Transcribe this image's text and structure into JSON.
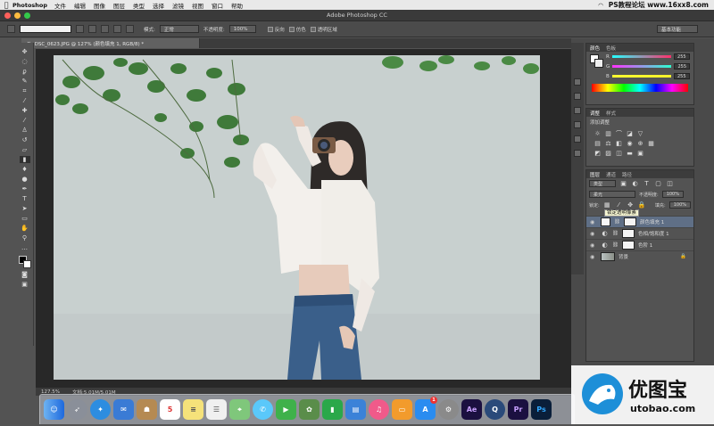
{
  "menubar": {
    "app_name": "Photoshop",
    "items": [
      "文件",
      "编辑",
      "图像",
      "图层",
      "类型",
      "选择",
      "滤镜",
      "视图",
      "窗口",
      "帮助"
    ],
    "watermark": "PS教程论坛 www.16xx8.com"
  },
  "window": {
    "title": "Adobe Photoshop CC"
  },
  "options": {
    "mode_label": "模式:",
    "mode_value": "正常",
    "opacity_label": "不透明度:",
    "opacity_value": "100%",
    "reverse_label": "反向",
    "dither_label": "仿色",
    "transparency_label": "透明区域",
    "workspace": "基本功能"
  },
  "document": {
    "tab_title": "DSC_0623.JPG @ 127% (颜色填充 1, RGB/8) *"
  },
  "status": {
    "zoom": "127.5%",
    "doc_info": "文档:5.01M/5.01M"
  },
  "color_panel": {
    "tabs": [
      "颜色",
      "色板"
    ],
    "channels": [
      {
        "label": "R",
        "value": "255",
        "color": "#ff2f6b"
      },
      {
        "label": "G",
        "value": "255",
        "color": "#2bffd0"
      },
      {
        "label": "B",
        "value": "255",
        "color": "#f5f02a"
      }
    ]
  },
  "adjustments_panel": {
    "tabs": [
      "调整",
      "样式"
    ],
    "title": "添加调整"
  },
  "layers_panel": {
    "tabs": [
      "图层",
      "通道",
      "路径"
    ],
    "kind": "类型",
    "blend_mode": "柔光",
    "opacity_label": "不透明度:",
    "opacity_value": "100%",
    "lock_label": "锁定:",
    "fill_label": "填充:",
    "fill_value": "100%",
    "tooltip": "锁定透明像素",
    "layers": [
      {
        "name": "颜色填充 1"
      },
      {
        "name": "色相/饱和度 1"
      },
      {
        "name": "色阶 1"
      },
      {
        "name": "背景"
      }
    ]
  },
  "dock": {
    "calendar_day": "5",
    "badge": "1",
    "app_labels": [
      "Ae",
      "Pr",
      "Ps"
    ]
  },
  "logo": {
    "name": "优图宝",
    "url": "utobao.com"
  }
}
